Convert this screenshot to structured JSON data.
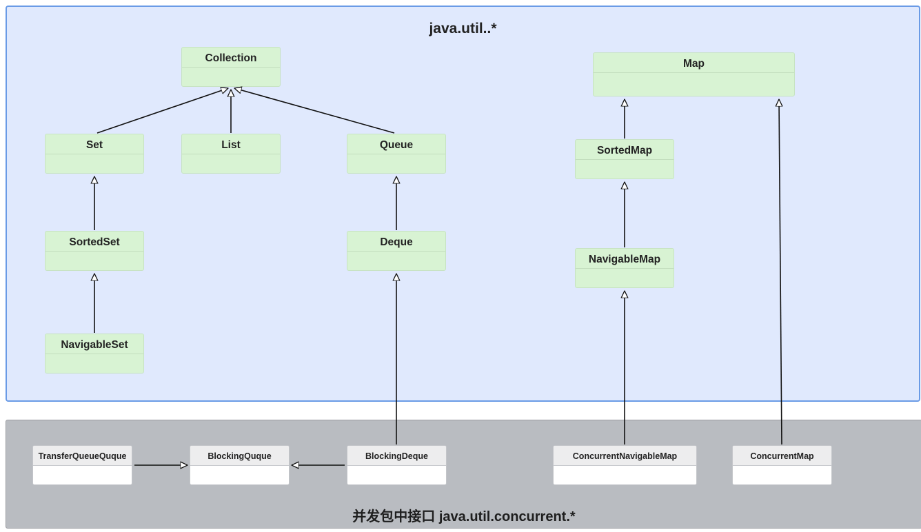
{
  "packages": {
    "util": {
      "title": "java.util..*"
    },
    "concurrent": {
      "title": "并发包中接口 java.util.concurrent.*"
    }
  },
  "classes": {
    "collection": "Collection",
    "set": "Set",
    "list": "List",
    "queue": "Queue",
    "sorted_set": "SortedSet",
    "navigable_set": "NavigableSet",
    "deque": "Deque",
    "map": "Map",
    "sorted_map": "SortedMap",
    "navigable_map": "NavigableMap",
    "transfer_queue": "TransferQueueQuque",
    "blocking_queue": "BlockingQuque",
    "blocking_deque": "BlockingDeque",
    "concurrent_navigable_map": "ConcurrentNavigableMap",
    "concurrent_map": "ConcurrentMap"
  },
  "relations": [
    {
      "from": "Set",
      "to": "Collection",
      "type": "extends"
    },
    {
      "from": "List",
      "to": "Collection",
      "type": "extends"
    },
    {
      "from": "Queue",
      "to": "Collection",
      "type": "extends"
    },
    {
      "from": "SortedSet",
      "to": "Set",
      "type": "extends"
    },
    {
      "from": "NavigableSet",
      "to": "SortedSet",
      "type": "extends"
    },
    {
      "from": "Deque",
      "to": "Queue",
      "type": "extends"
    },
    {
      "from": "BlockingDeque",
      "to": "Deque",
      "type": "extends"
    },
    {
      "from": "SortedMap",
      "to": "Map",
      "type": "extends"
    },
    {
      "from": "NavigableMap",
      "to": "SortedMap",
      "type": "extends"
    },
    {
      "from": "ConcurrentNavigableMap",
      "to": "NavigableMap",
      "type": "extends"
    },
    {
      "from": "ConcurrentMap",
      "to": "Map",
      "type": "extends"
    },
    {
      "from": "TransferQueueQuque",
      "to": "BlockingQuque",
      "type": "extends"
    },
    {
      "from": "BlockingDeque",
      "to": "BlockingQuque",
      "type": "extends"
    }
  ],
  "colors": {
    "util_package_bg": "#e0e9fd",
    "util_package_border": "#6a9be6",
    "concurrent_package_bg": "#b9bcc1",
    "class_green": "#d8f3d3",
    "class_white": "#ffffff",
    "edge": "#111111"
  }
}
